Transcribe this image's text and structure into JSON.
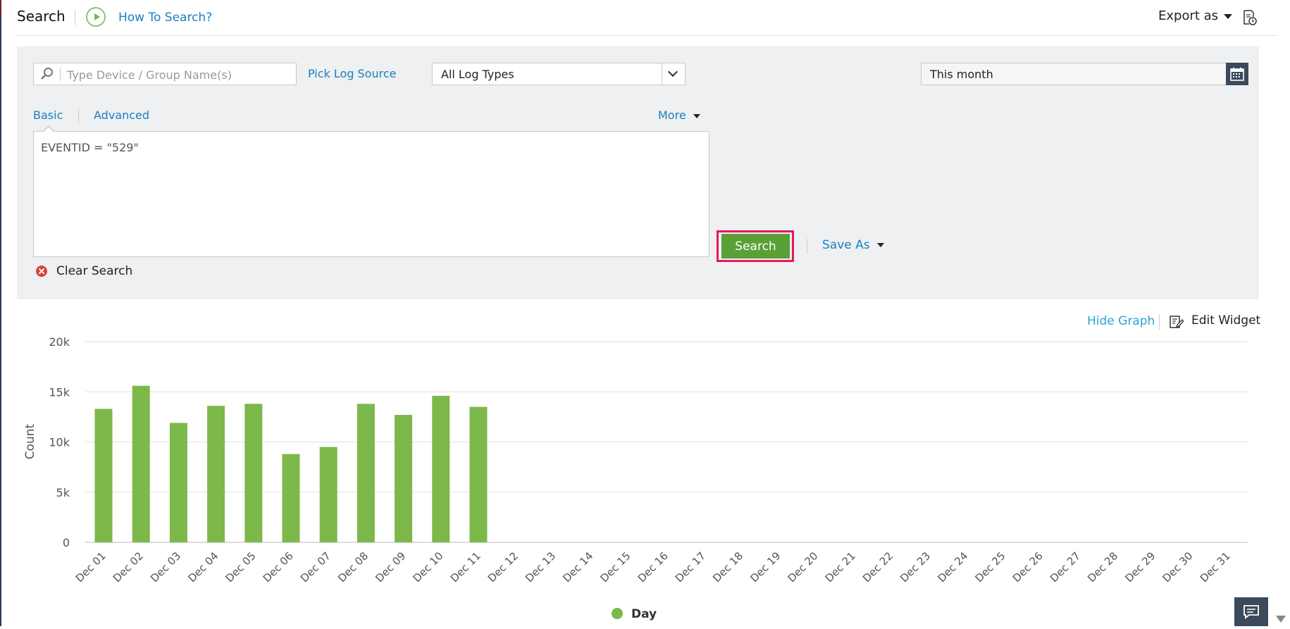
{
  "header": {
    "title": "Search",
    "how_to_link": "How To Search?",
    "export_label": "Export as"
  },
  "search_panel": {
    "device_placeholder": "Type Device / Group Name(s)",
    "pick_log_source": "Pick Log Source",
    "log_type_selected": "All Log Types",
    "date_range": "This month",
    "tabs": {
      "basic": "Basic",
      "advanced": "Advanced"
    },
    "more_label": "More",
    "query": "EVENTID = \"529\"",
    "search_button": "Search",
    "save_as_label": "Save As",
    "clear_search": "Clear Search"
  },
  "graph_controls": {
    "hide_graph": "Hide Graph",
    "edit_widget": "Edit Widget"
  },
  "chart_data": {
    "type": "bar",
    "ylabel": "Count",
    "xlabel": "",
    "ylim": [
      0,
      20000
    ],
    "yticks": [
      0,
      5000,
      10000,
      15000,
      20000
    ],
    "ytick_labels": [
      "0",
      "5k",
      "10k",
      "15k",
      "20k"
    ],
    "categories": [
      "Dec 01",
      "Dec 02",
      "Dec 03",
      "Dec 04",
      "Dec 05",
      "Dec 06",
      "Dec 07",
      "Dec 08",
      "Dec 09",
      "Dec 10",
      "Dec 11",
      "Dec 12",
      "Dec 13",
      "Dec 14",
      "Dec 15",
      "Dec 16",
      "Dec 17",
      "Dec 18",
      "Dec 19",
      "Dec 20",
      "Dec 21",
      "Dec 22",
      "Dec 23",
      "Dec 24",
      "Dec 25",
      "Dec 26",
      "Dec 27",
      "Dec 28",
      "Dec 29",
      "Dec 30",
      "Dec 31"
    ],
    "series": [
      {
        "name": "Day",
        "color": "#7cb84a",
        "values": [
          13300,
          15600,
          11900,
          13600,
          13800,
          8800,
          9500,
          13800,
          12700,
          14600,
          13500,
          0,
          0,
          0,
          0,
          0,
          0,
          0,
          0,
          0,
          0,
          0,
          0,
          0,
          0,
          0,
          0,
          0,
          0,
          0,
          0
        ]
      }
    ],
    "grid": true,
    "legend_position": "bottom-center"
  },
  "colors": {
    "accent_link": "#1a7fbf",
    "search_button": "#5aa036",
    "highlight_frame": "#e8175d",
    "bar": "#7cb84a"
  },
  "icons": {
    "play": "play-circle-icon",
    "search": "magnifier-icon",
    "calendar": "calendar-icon",
    "clear": "clear-x-icon",
    "edit": "edit-widget-icon",
    "chat": "chat-icon"
  }
}
